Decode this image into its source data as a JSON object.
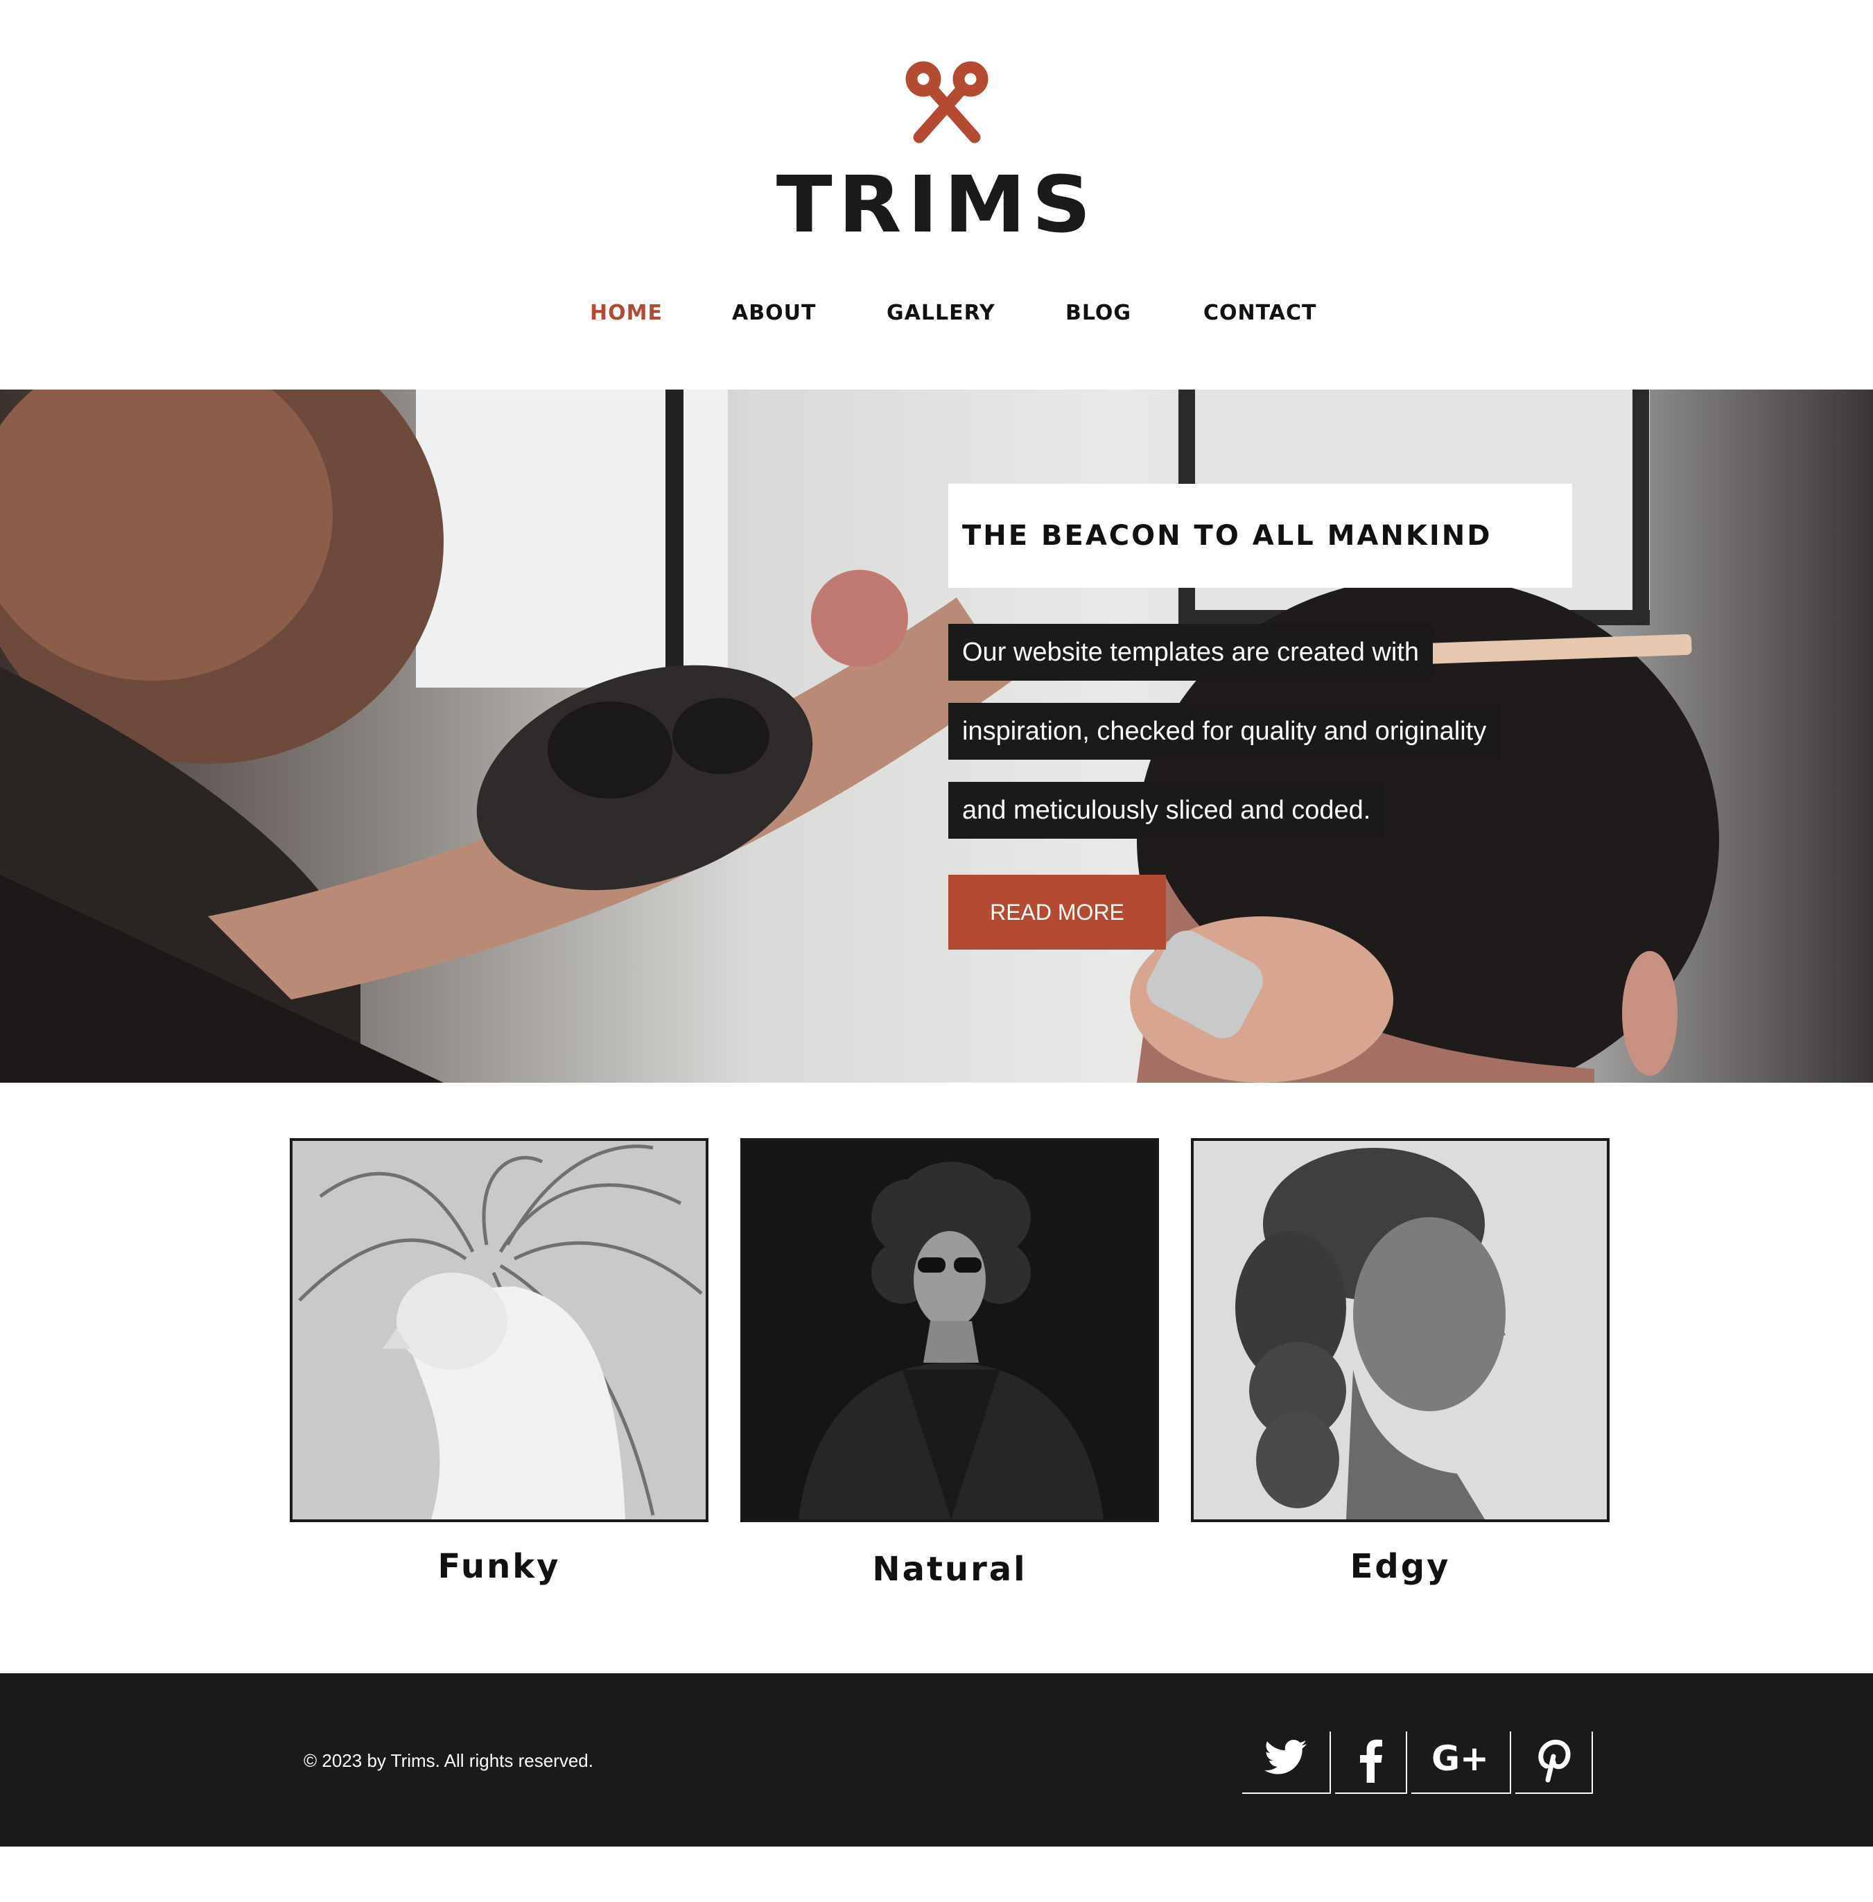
{
  "brand": {
    "name": "TRIMS",
    "logo_icon": "scissors-icon",
    "accent_color": "#b34a31",
    "dark_color": "#1b191a"
  },
  "nav": {
    "items": [
      {
        "label": "HOME",
        "active": true
      },
      {
        "label": "ABOUT",
        "active": false
      },
      {
        "label": "GALLERY",
        "active": false
      },
      {
        "label": "BLOG",
        "active": false
      },
      {
        "label": "CONTACT",
        "active": false
      }
    ]
  },
  "hero": {
    "title": "THE BEACON TO ALL MANKIND",
    "lines": [
      "Our website templates are created with",
      "inspiration, checked for quality and originality",
      "and meticulously sliced and coded."
    ],
    "button_label": "READ MORE"
  },
  "styles": [
    {
      "label": "Funky"
    },
    {
      "label": "Natural"
    },
    {
      "label": "Edgy"
    }
  ],
  "footer": {
    "copyright": "© 2023 by Trims. All rights reserved.",
    "social": [
      "twitter-icon",
      "facebook-icon",
      "google-plus-icon",
      "pinterest-icon"
    ]
  }
}
